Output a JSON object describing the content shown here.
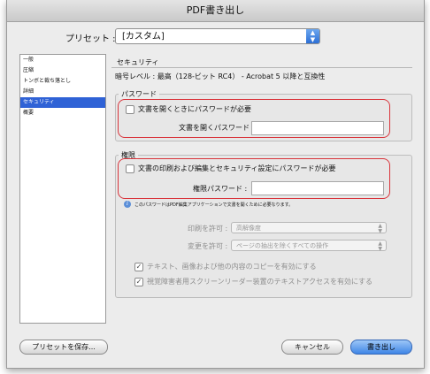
{
  "window": {
    "title": "PDF書き出し"
  },
  "preset": {
    "label": "プリセット :",
    "value": "[カスタム]"
  },
  "sidebar": {
    "items": [
      {
        "label": "一般",
        "selected": false
      },
      {
        "label": "圧縮",
        "selected": false
      },
      {
        "label": "トンボと裁ち落とし",
        "selected": false
      },
      {
        "label": "詳細",
        "selected": false
      },
      {
        "label": "セキュリティ",
        "selected": true
      },
      {
        "label": "概要",
        "selected": false
      }
    ]
  },
  "security": {
    "title": "セキュリティ",
    "encryption_level": "暗号レベル : 最高（128-ビット RC4） - Acrobat 5 以降と互換性",
    "password_group": {
      "label": "パスワード",
      "checkbox_label": "文書を開くときにパスワードが必要",
      "checked": false,
      "field_label": "文書を開くパスワード :",
      "field_value": ""
    },
    "permissions_group": {
      "label": "権限",
      "checkbox_label": "文書の印刷および編集とセキュリティ設定にパスワードが必要",
      "checked": false,
      "field_label": "権限パスワード :",
      "field_value": "",
      "note": "このパスワードはPDF編集アプリケーションで文書を開くために必要なります。",
      "print_label": "印刷を許可 :",
      "print_value": "高解像度",
      "change_label": "変更を許可 :",
      "change_value": "ページの抽出を除くすべての操作",
      "copy_checkbox_label": "テキスト、画像および他の内容のコピーを有効にする",
      "copy_checked": true,
      "access_checkbox_label": "視覚障害者用スクリーンリーダー装置のテキストアクセスを有効にする",
      "access_checked": true
    }
  },
  "buttons": {
    "save_preset": "プリセットを保存...",
    "cancel": "キャンセル",
    "export": "書き出し"
  },
  "colors": {
    "highlight": "#d9343b",
    "selection": "#2f62d6",
    "default_button": "#3f86e6"
  }
}
